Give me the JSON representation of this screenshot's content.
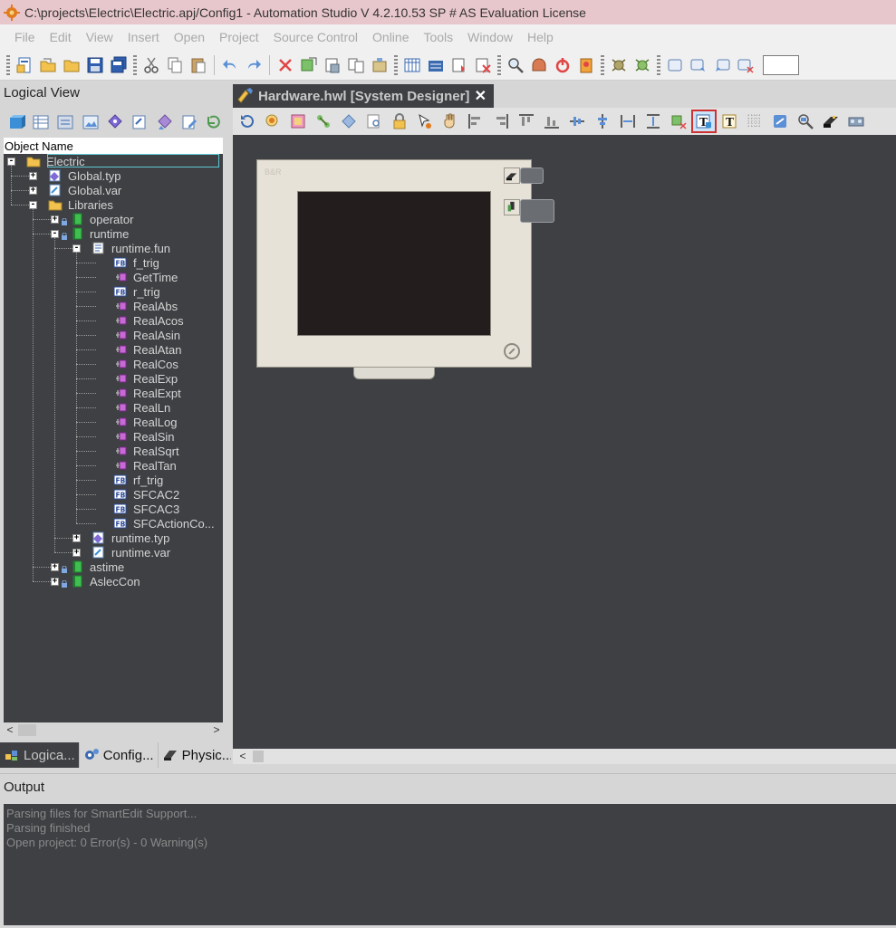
{
  "window": {
    "title": "C:\\projects\\Electric\\Electric.apj/Config1 - Automation Studio V 4.2.10.53 SP # AS Evaluation License"
  },
  "menu": [
    "File",
    "Edit",
    "View",
    "Insert",
    "Open",
    "Project",
    "Source Control",
    "Online",
    "Tools",
    "Window",
    "Help"
  ],
  "logical_view": {
    "title": "Logical View",
    "column_header": "Object Name",
    "tree": [
      {
        "label": "Electric",
        "icon": "folder-icon",
        "selected": true
      },
      {
        "label": "Global.typ",
        "icon": "type-file-icon"
      },
      {
        "label": "Global.var",
        "icon": "var-file-icon"
      },
      {
        "label": "Libraries",
        "icon": "folder-icon"
      },
      {
        "label": "operator",
        "icon": "library-icon"
      },
      {
        "label": "runtime",
        "icon": "library-icon"
      },
      {
        "label": "runtime.fun",
        "icon": "function-file-icon"
      },
      {
        "label": "f_trig",
        "icon": "fb-icon"
      },
      {
        "label": "GetTime",
        "icon": "function-icon"
      },
      {
        "label": "r_trig",
        "icon": "fb-icon"
      },
      {
        "label": "RealAbs",
        "icon": "function-icon"
      },
      {
        "label": "RealAcos",
        "icon": "function-icon"
      },
      {
        "label": "RealAsin",
        "icon": "function-icon"
      },
      {
        "label": "RealAtan",
        "icon": "function-icon"
      },
      {
        "label": "RealCos",
        "icon": "function-icon"
      },
      {
        "label": "RealExp",
        "icon": "function-icon"
      },
      {
        "label": "RealExpt",
        "icon": "function-icon"
      },
      {
        "label": "RealLn",
        "icon": "function-icon"
      },
      {
        "label": "RealLog",
        "icon": "function-icon"
      },
      {
        "label": "RealSin",
        "icon": "function-icon"
      },
      {
        "label": "RealSqrt",
        "icon": "function-icon"
      },
      {
        "label": "RealTan",
        "icon": "function-icon"
      },
      {
        "label": "rf_trig",
        "icon": "fb-icon"
      },
      {
        "label": "SFCAC2",
        "icon": "fb-icon"
      },
      {
        "label": "SFCAC3",
        "icon": "fb-icon"
      },
      {
        "label": "SFCActionCo...",
        "icon": "fb-icon"
      },
      {
        "label": "runtime.typ",
        "icon": "type-file-icon"
      },
      {
        "label": "runtime.var",
        "icon": "var-file-icon"
      },
      {
        "label": "astime",
        "icon": "library-icon"
      },
      {
        "label": "AslecCon",
        "icon": "library-icon"
      }
    ],
    "fb_badge": "FB",
    "tabs": [
      {
        "label": "Logica...",
        "icon": "logical-view-icon",
        "active": true
      },
      {
        "label": "Config...",
        "icon": "configuration-view-icon"
      },
      {
        "label": "Physic...",
        "icon": "physical-view-icon"
      }
    ]
  },
  "document": {
    "tab_label": "Hardware.hwl [System Designer]",
    "close_glyph": "✕",
    "device_brand": "B&R"
  },
  "output": {
    "title": "Output",
    "lines": [
      "Parsing files for SmartEdit Support...",
      "Parsing finished",
      "Open project: 0 Error(s) - 0 Warning(s)"
    ]
  },
  "colors": {
    "titlebar_bg": "#e8c7cc",
    "panel_dark": "#3e4043",
    "menu_text_disabled": "#a9a9a9",
    "highlight_outline": "#d03030"
  }
}
